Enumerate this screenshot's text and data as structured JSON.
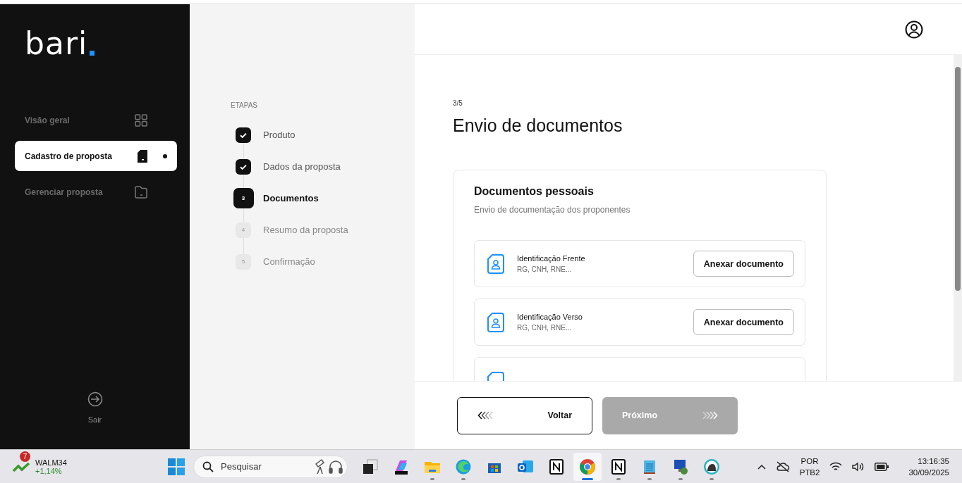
{
  "sidebar": {
    "logo": "bari",
    "nav": [
      {
        "label": "Visão geral",
        "selected": false
      },
      {
        "label": "Cadastro de proposta",
        "selected": true
      },
      {
        "label": "Gerenciar proposta",
        "selected": false
      }
    ],
    "logout": "Sair"
  },
  "steps": {
    "heading": "ETAPAS",
    "items": [
      {
        "label": "Produto",
        "done": true,
        "selected": false
      },
      {
        "label": "Dados da proposta",
        "done": true,
        "selected": false
      },
      {
        "number": "3",
        "label": "Documentos",
        "done": false,
        "selected": true
      },
      {
        "number": "4",
        "label": "Resumo da proposta",
        "done": false,
        "selected": false
      },
      {
        "number": "5",
        "label": "Confirmação",
        "done": false,
        "selected": false
      }
    ]
  },
  "main": {
    "step_counter": "3/5",
    "title": "Envio de documentos",
    "card": {
      "title": "Documentos pessoais",
      "subtitle": "Envio de documentação dos proponentes",
      "documents": [
        {
          "name": "Identificação Frente",
          "hint": "RG, CNH, RNE...",
          "button": "Anexar documento"
        },
        {
          "name": "Identificação Verso",
          "hint": "RG, CNH, RNE...",
          "button": "Anexar documento"
        }
      ]
    }
  },
  "footer": {
    "back": {
      "label": "Voltar"
    },
    "next": {
      "label": "Próximo",
      "disabled": true
    }
  },
  "taskbar": {
    "widget": {
      "badge": "7",
      "ticker": "WALM34",
      "change": "+1,14%"
    },
    "search": {
      "placeholder": "Pesquisar"
    },
    "apps": [
      {
        "kind": "taskview",
        "running": false,
        "selected": false
      },
      {
        "kind": "copilot",
        "running": false,
        "selected": false
      },
      {
        "kind": "explorer",
        "running": true,
        "selected": false
      },
      {
        "kind": "edge",
        "running": true,
        "selected": false
      },
      {
        "kind": "store",
        "running": false,
        "selected": false
      },
      {
        "kind": "outlook",
        "running": false,
        "selected": false
      },
      {
        "kind": "notion",
        "running": false,
        "selected": false
      },
      {
        "kind": "chrome",
        "running": true,
        "selected": true
      },
      {
        "kind": "notion",
        "running": true,
        "selected": false
      },
      {
        "kind": "notepad",
        "running": true,
        "selected": false
      },
      {
        "kind": "remote",
        "running": true,
        "selected": false
      },
      {
        "kind": "beaver",
        "running": true,
        "selected": false
      }
    ],
    "tray": {
      "language": "POR",
      "layout": "PTB2",
      "time": "13:16:35",
      "date": "30/09/2025"
    }
  }
}
